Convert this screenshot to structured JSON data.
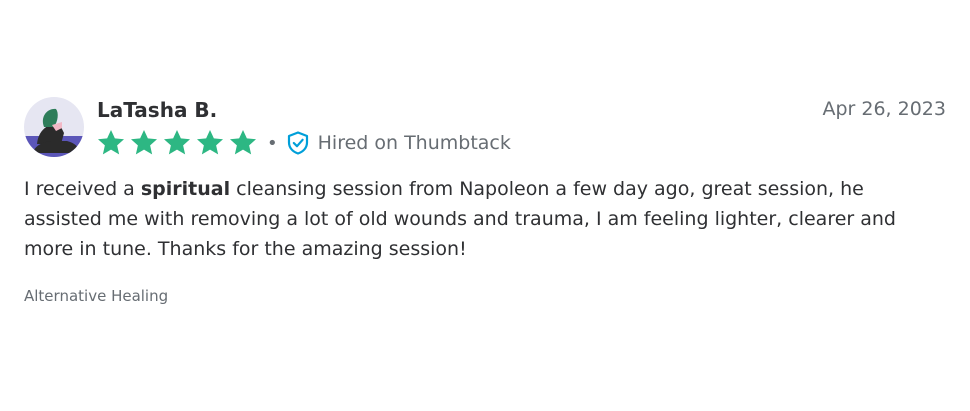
{
  "review": {
    "reviewer_name": "LaTasha B.",
    "date": "Apr 26, 2023",
    "rating": 5,
    "rating_max": 5,
    "star_color": "#2db783",
    "separator": "•",
    "hired_label": "Hired on Thumbtack",
    "hired_icon": "shield-check-icon",
    "avatar_icon": "avatar-illustration",
    "text_before": "I received a ",
    "text_bold": "spiritual",
    "text_after": " cleansing session from Napoleon a few day ago, great session, he assisted me with removing a lot of old wounds and trauma, I am feeling lighter, clearer and more in tune. Thanks for the amazing session!",
    "category": "Alternative Healing"
  }
}
